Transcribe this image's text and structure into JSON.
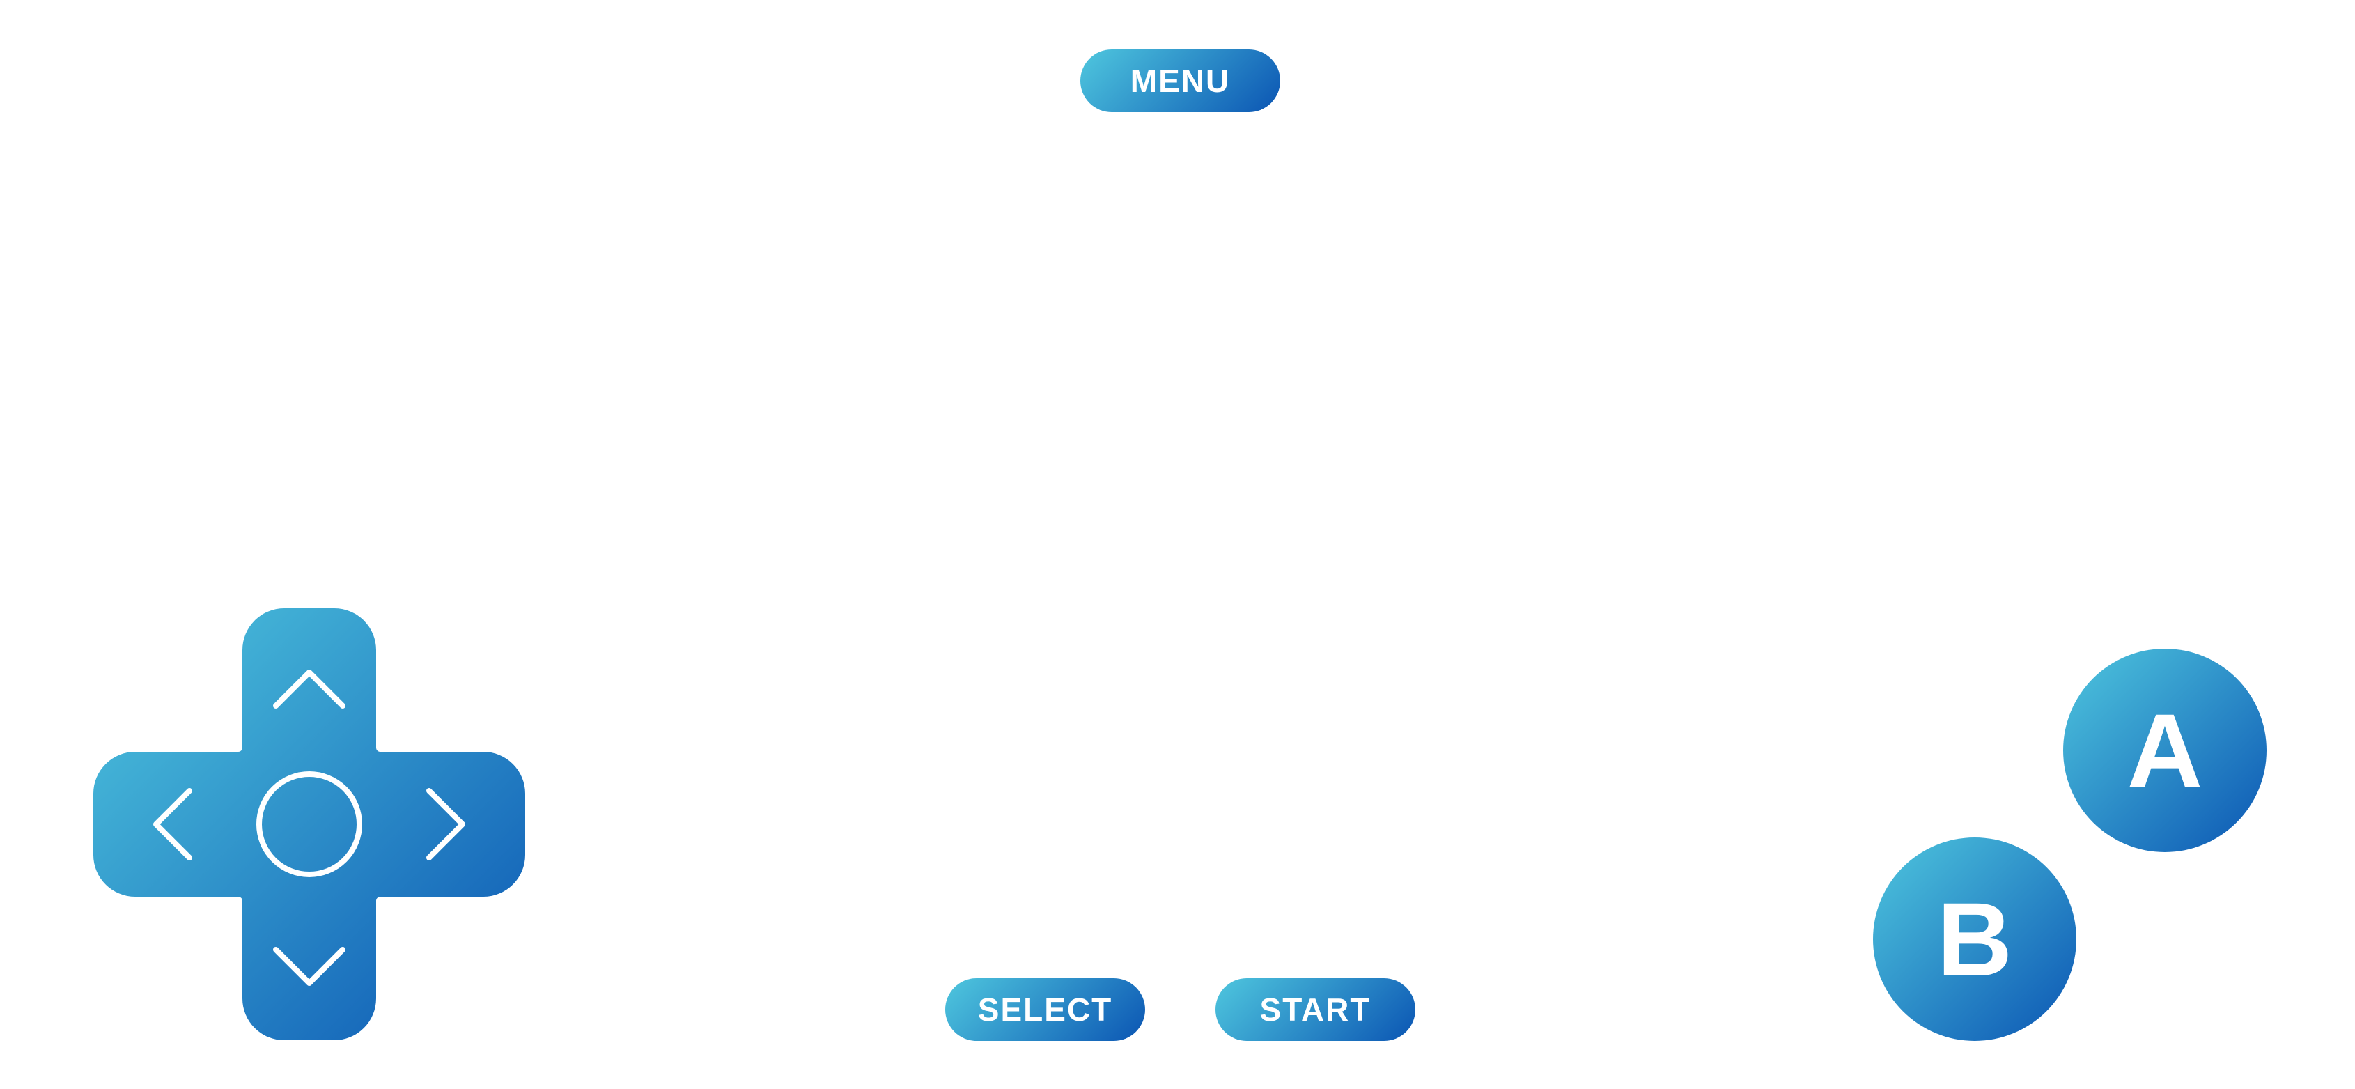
{
  "controls": {
    "menu_label": "MENU",
    "select_label": "SELECT",
    "start_label": "START",
    "a_label": "A",
    "b_label": "B"
  },
  "dpad": {
    "up_icon": "chevron-up-icon",
    "down_icon": "chevron-down-icon",
    "left_icon": "chevron-left-icon",
    "right_icon": "chevron-right-icon",
    "center_icon": "circle-icon"
  },
  "colors": {
    "gradient_light": "#4fc7de",
    "gradient_dark": "#0b55b3",
    "background": "#ffffff",
    "foreground": "#ffffff"
  }
}
